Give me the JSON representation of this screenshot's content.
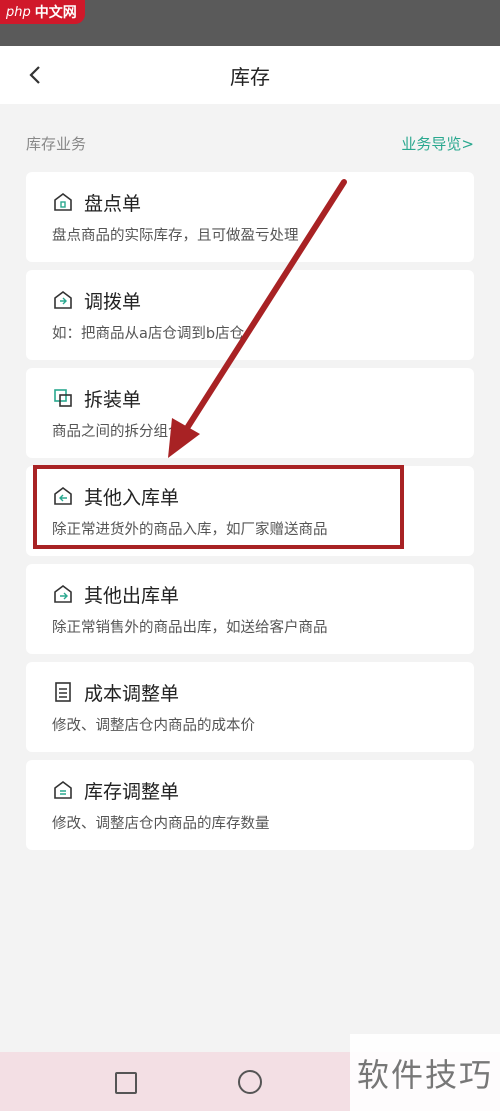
{
  "watermark_top": {
    "php": "php",
    "cn": "中文网"
  },
  "header": {
    "title": "库存"
  },
  "section": {
    "title": "库存业务",
    "guide_link": "业务导览>"
  },
  "cards": [
    {
      "title": "盘点单",
      "desc": "盘点商品的实际库存，且可做盈亏处理",
      "icon": "stocktake-icon"
    },
    {
      "title": "调拨单",
      "desc": "如：把商品从a店仓调到b店仓",
      "icon": "transfer-icon"
    },
    {
      "title": "拆装单",
      "desc": "商品之间的拆分组合",
      "icon": "split-combine-icon"
    },
    {
      "title": "其他入库单",
      "desc": "除正常进货外的商品入库，如厂家赠送商品",
      "icon": "inbound-icon"
    },
    {
      "title": "其他出库单",
      "desc": "除正常销售外的商品出库，如送给客户商品",
      "icon": "outbound-icon"
    },
    {
      "title": "成本调整单",
      "desc": "修改、调整店仓内商品的成本价",
      "icon": "document-icon"
    },
    {
      "title": "库存调整单",
      "desc": "修改、调整店仓内商品的库存数量",
      "icon": "stock-adjust-icon"
    }
  ],
  "colors": {
    "accent": "#2aa88f",
    "annotation": "#a82224"
  },
  "watermark_bottom": {
    "text": "软件技巧"
  }
}
